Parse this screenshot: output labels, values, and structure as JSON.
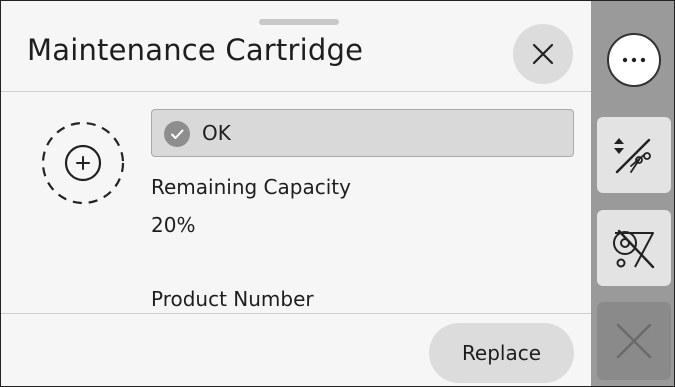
{
  "header": {
    "title": "Maintenance Cartridge"
  },
  "status": {
    "text": "OK"
  },
  "details": {
    "remaining_label": "Remaining Capacity",
    "remaining_value": "20%",
    "product_label": "Product Number"
  },
  "actions": {
    "replace_label": "Replace"
  },
  "icons": {
    "close": "close-icon",
    "cartridge": "maintenance-cartridge-icon",
    "check": "check-icon",
    "more": "more-options-icon",
    "cut": "cut-paper-icon",
    "no_roll": "no-roll-icon",
    "cancel": "cancel-icon"
  },
  "colors": {
    "panel_bg": "#f6f6f6",
    "sidebar_bg": "#9a9a9a",
    "status_bg": "#d9d9d9",
    "button_bg": "#dcdcdc"
  }
}
